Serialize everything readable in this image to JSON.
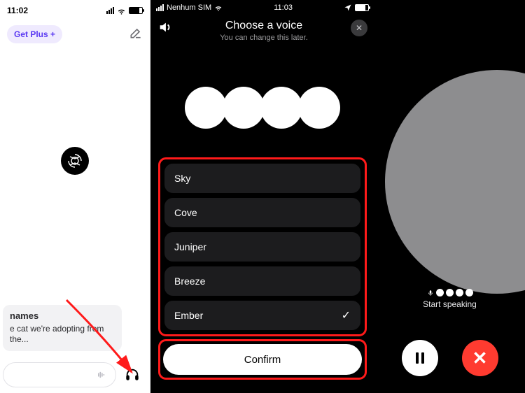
{
  "left": {
    "status": {
      "time": "11:02"
    },
    "getplus_label": "Get Plus +",
    "suggestion_title": "names",
    "suggestion_body": "e cat we're adopting from the..."
  },
  "mid": {
    "status": {
      "carrier": "Nenhum SIM",
      "time": "11:03"
    },
    "title": "Choose a voice",
    "subtitle": "You can change this later.",
    "voices": [
      {
        "label": "Sky",
        "selected": false
      },
      {
        "label": "Cove",
        "selected": false
      },
      {
        "label": "Juniper",
        "selected": false
      },
      {
        "label": "Breeze",
        "selected": false
      },
      {
        "label": "Ember",
        "selected": true
      }
    ],
    "confirm_label": "Confirm"
  },
  "right": {
    "start_label": "Start speaking"
  }
}
